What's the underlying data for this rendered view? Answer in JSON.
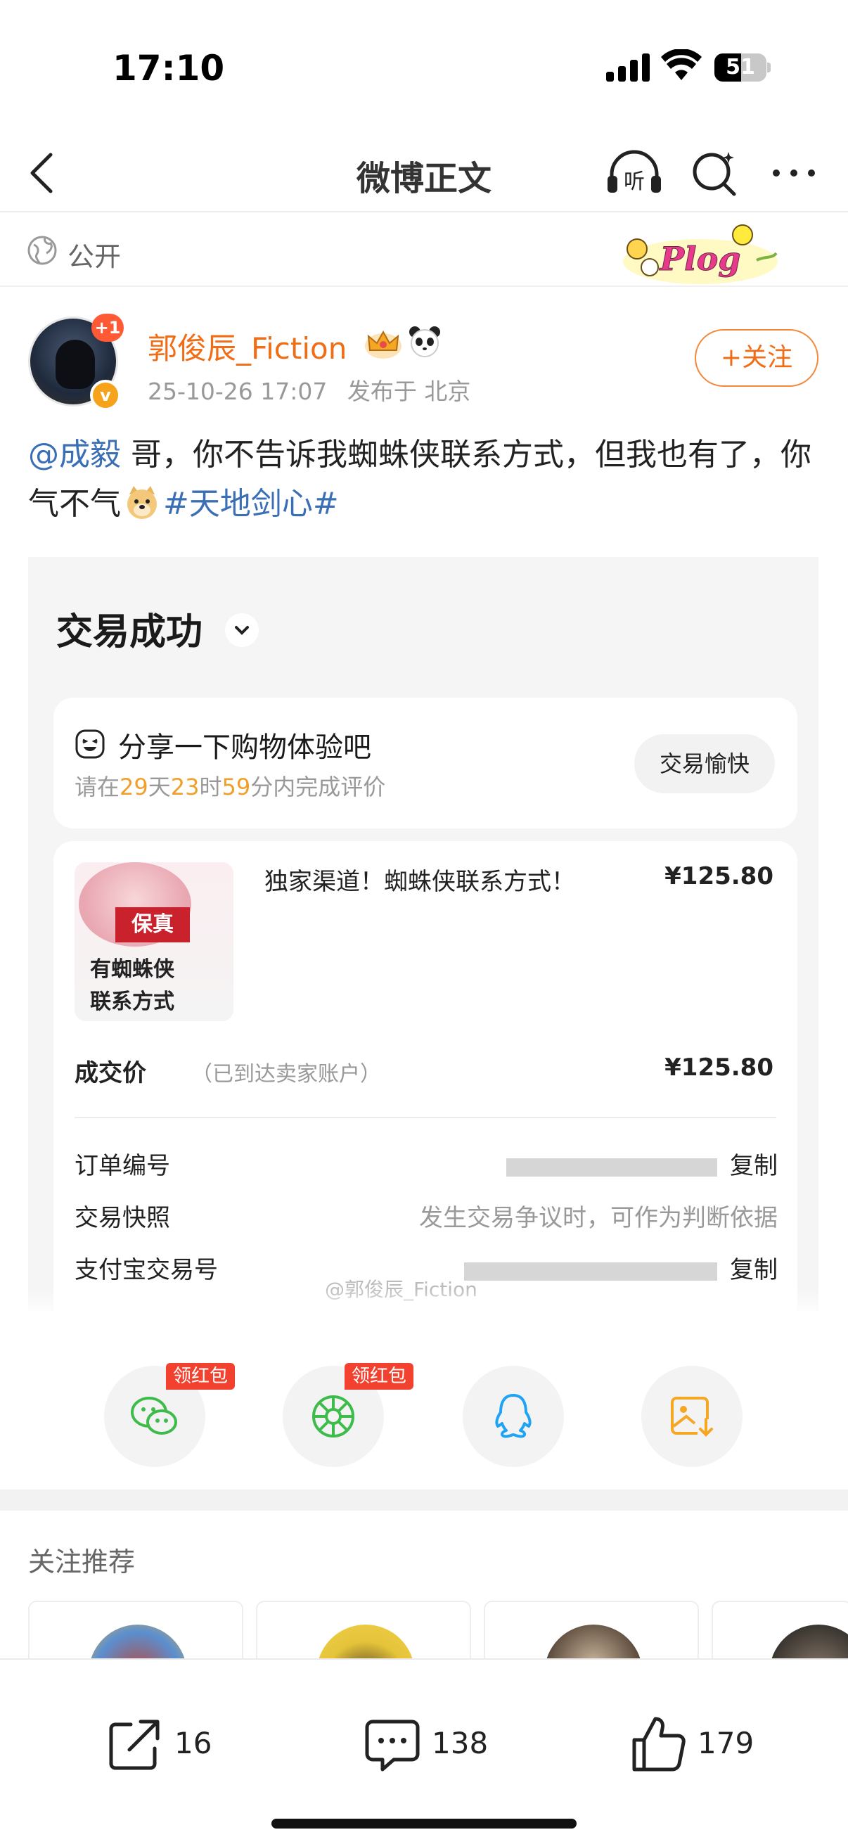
{
  "status_bar": {
    "time": "17:10",
    "battery": "51"
  },
  "nav": {
    "title": "微博正文"
  },
  "visibility": {
    "label": "公开",
    "sticker": "Plog"
  },
  "author": {
    "name": "郭俊辰_Fiction",
    "badge_count": "+1",
    "date": "25-10-26 17:07",
    "location": "发布于 北京",
    "follow_label": "+关注"
  },
  "post": {
    "mention": "@成毅",
    "text": " 哥，你不告诉我蜘蛛侠联系方式，但我也有了，你气不气",
    "topic": "#天地剑心#"
  },
  "order_image": {
    "status_title": "交易成功",
    "share_title": "分享一下购物体验吧",
    "share_sub_prefix": "请在",
    "days": "29",
    "days_unit": "天",
    "hours": "23",
    "hours_unit": "时",
    "minutes": "59",
    "share_sub_suffix": "分内完成评价",
    "happy_button": "交易愉快",
    "thumb_label": "保真",
    "thumb_text_1": "有蜘蛛侠",
    "thumb_text_2": "联系方式",
    "product_name": "独家渠道！蜘蛛侠联系方式！",
    "product_price": "¥125.80",
    "deal_label": "成交价",
    "deal_note": "（已到达卖家账户）",
    "deal_price": "¥125.80",
    "order_no_label": "订单编号",
    "copy_label": "复制",
    "snapshot_label": "交易快照",
    "snapshot_value": "发生交易争议时，可作为判断依据",
    "alipay_label": "支付宝交易号",
    "copy_label_2": "复制",
    "watermark": "@郭俊辰_Fiction"
  },
  "share_row": {
    "redpack_1": "领红包",
    "redpack_2": "领红包"
  },
  "recommend": {
    "title": "关注推荐"
  },
  "actions": {
    "repost_count": "16",
    "comment_count": "138",
    "like_count": "179"
  }
}
